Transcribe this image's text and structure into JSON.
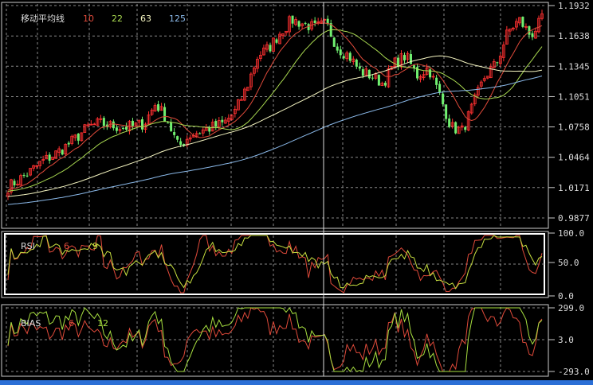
{
  "chart_data": [
    {
      "type": "candlestick",
      "title": "移动平均线",
      "legend": [
        {
          "label": "10",
          "color": "#e04a3a"
        },
        {
          "label": "22",
          "color": "#a8d850"
        },
        {
          "label": "63",
          "color": "#f4f4c0"
        },
        {
          "label": "125",
          "color": "#8ab8e8"
        }
      ],
      "y_ticks": [
        "1.1932",
        "1.1638",
        "1.1345",
        "1.1051",
        "1.0758",
        "1.0464",
        "1.0171",
        "0.9877"
      ],
      "ylim": [
        0.9877,
        1.1932
      ],
      "close_anchors": [
        1.0176,
        1.025,
        1.033,
        1.042,
        1.0484,
        1.0561,
        1.065,
        1.0754,
        1.0792,
        1.077,
        1.0754,
        1.076,
        1.0792,
        1.0985,
        1.0831,
        1.056,
        1.0677,
        1.072,
        1.0754,
        1.0792,
        1.0908,
        1.1139,
        1.1447,
        1.1524,
        1.1678,
        1.1793,
        1.1755,
        1.1716,
        1.1755,
        1.1524,
        1.1447,
        1.1293,
        1.1254,
        1.1177,
        1.137,
        1.1447,
        1.1254,
        1.1331,
        1.1062,
        1.0754,
        1.072,
        1.0985,
        1.1254,
        1.137,
        1.1678,
        1.1793,
        1.1639,
        1.1793
      ],
      "up_color": "#ff3030",
      "down_color": "#70f070"
    },
    {
      "type": "line",
      "title": "RSI",
      "legend": [
        {
          "label": "6",
          "color": "#e04a3a"
        },
        {
          "label": "9",
          "color": "#c8e040"
        }
      ],
      "y_ticks": [
        "100.0",
        "50.0",
        "0.0"
      ],
      "ylim": [
        0,
        100
      ]
    },
    {
      "type": "line",
      "title": "BIAS",
      "legend": [
        {
          "label": "6",
          "color": "#e04a3a"
        },
        {
          "label": "12",
          "color": "#a8e040"
        }
      ],
      "y_ticks": [
        "299.0",
        "3.0",
        "-293.0"
      ],
      "ylim": [
        -293,
        299
      ]
    }
  ]
}
